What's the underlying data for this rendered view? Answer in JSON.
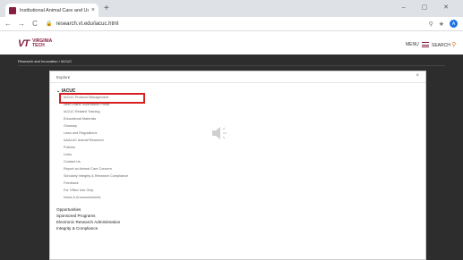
{
  "browser": {
    "tab_title": "Institutional Animal Care and Us",
    "tab_close": "×",
    "new_tab": "+",
    "window_controls": "– ▢ ✕",
    "back": "←",
    "forward": "→",
    "reload": "C",
    "url": "research.vt.edu/iacuc.html",
    "avatar_letter": "A"
  },
  "site": {
    "logo_mark": "VT",
    "logo_line1": "VIRGINIA",
    "logo_line2": "TECH",
    "menu_label": "MENU",
    "search_label": "SEARCH",
    "breadcrumb": "Research and Innovation  /  IACUC"
  },
  "panel": {
    "title": "Explore",
    "close": "×",
    "group": "⌄ IACUC",
    "children": [
      "IACUC Protocol Management",
      "New Online Submission Portal",
      "IACUC Related Training",
      "Educational Materials",
      "Glossary",
      "Laws and Regulations",
      "AAALAC Animal Research",
      "Policies",
      "Links",
      "Contact Us",
      "Report an Animal Care Concern",
      "Scholarly Integrity & Research Compliance",
      "Feedback",
      "For Office Use Only",
      "News & Announcements"
    ],
    "top_items": [
      "Opportunities",
      "Sponsored Programs",
      "Electronic Research Administration",
      "Integrity & Compliance"
    ]
  },
  "colors": {
    "brand": "#861f41",
    "accent": "#e5751f",
    "highlight": "#d62020"
  },
  "icons": {
    "speaker": "speaker-loading-icon"
  }
}
